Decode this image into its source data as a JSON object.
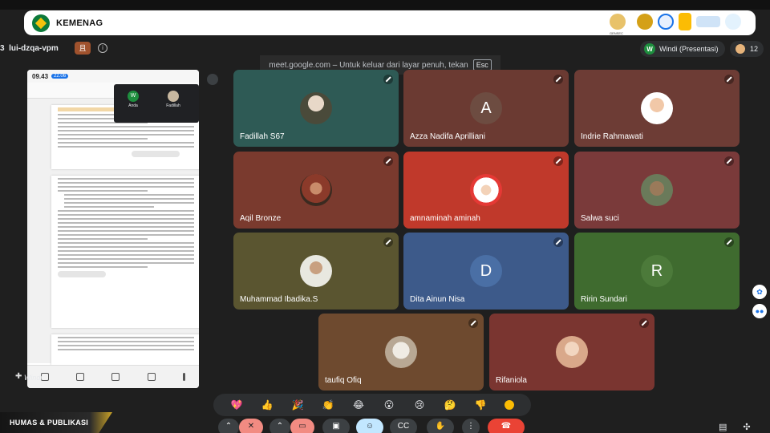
{
  "header": {
    "org_name": "KEMENAG",
    "logo_icon": "kemenag-emblem-icon",
    "partner_caption": "GENSEC"
  },
  "meeting": {
    "code": "lui-dzqa-vpm",
    "code_prefix": "3",
    "host_badge": "且",
    "presenter_initial": "W",
    "presenter_label": "Windi (Presentasi)",
    "participant_count": "12",
    "fullscreen_notice": "meet.google.com – Untuk keluar dari layar penuh, tekan",
    "esc_key": "Esc"
  },
  "shared_screen": {
    "phone_time": "09.43",
    "phone_badge": "22.06",
    "thumb_1_initial": "W",
    "thumb_1_name": "Anda",
    "thumb_2_name": "Fadillah",
    "presenter_name": "Windi"
  },
  "participants": [
    {
      "name": "Fadillah S67",
      "color": "#2e5a55",
      "avatar": "photo"
    },
    {
      "name": "Azza Nadifa Aprilliani",
      "color": "#6b3a32",
      "avatar": "A",
      "letter_color": "#6d4c41"
    },
    {
      "name": "Indrie Rahmawati",
      "color": "#6d3c35",
      "avatar": "photo"
    },
    {
      "name": "Aqil Bronze",
      "color": "#7a3a2e",
      "avatar": "photo"
    },
    {
      "name": "amnaminah aminah",
      "color": "#c0392b",
      "avatar": "photo"
    },
    {
      "name": "Salwa suci",
      "color": "#7a3a3a",
      "avatar": "photo"
    },
    {
      "name": "Muhammad Ibadika.S",
      "color": "#5a5530",
      "avatar": "photo"
    },
    {
      "name": "Dita Ainun Nisa",
      "color": "#3d5a8a",
      "avatar": "D",
      "letter_color": "#4a6fa5"
    },
    {
      "name": "Ririn Sundari",
      "color": "#3f6b2f",
      "avatar": "R",
      "letter_color": "#4c7a3a"
    },
    {
      "name": "taufiq Ofiq",
      "color": "#6e4a2f",
      "avatar": "photo"
    },
    {
      "name": "Rifaniola",
      "color": "#7a3530",
      "avatar": "photo"
    }
  ],
  "reactions": [
    "💖",
    "👍",
    "🎉",
    "👏",
    "😂",
    "😮",
    "😢",
    "🤔",
    "👎"
  ],
  "banner": {
    "label": "HUMAS & PUBLIKASI"
  },
  "colors": {
    "background": "#1f1f1f",
    "end_call": "#ea4335",
    "mic_off": "#f28b82",
    "active_control": "#c2e7ff"
  }
}
